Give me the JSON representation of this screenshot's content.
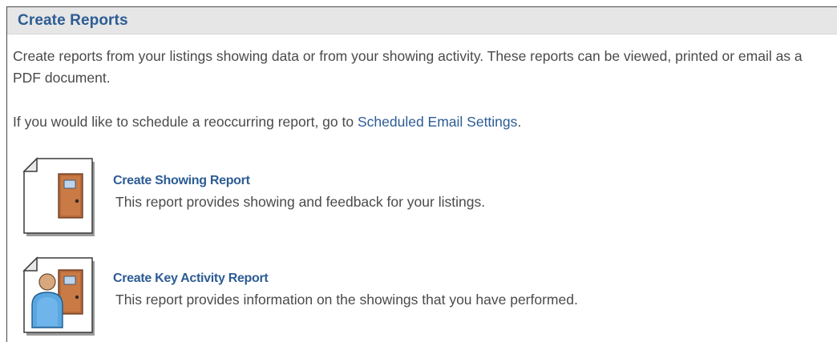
{
  "header": {
    "title": "Create Reports"
  },
  "intro": {
    "text": "Create reports from your listings showing data or from your showing activity. These reports can be viewed, printed or email as a PDF document."
  },
  "schedule": {
    "prefix": "If you would like to schedule a reoccurring report, go to ",
    "link_label": "Scheduled Email Settings",
    "suffix": "."
  },
  "reports": [
    {
      "title": "Create Showing Report",
      "description": "This report provides showing and feedback for your listings.",
      "icon": "door-document-icon"
    },
    {
      "title": "Create Key Activity Report",
      "description": "This report provides information on the showings that you have performed.",
      "icon": "person-door-document-icon"
    }
  ],
  "colors": {
    "link": "#2d5c94",
    "text": "#4a4a4a",
    "header_bg": "#e6e6e6"
  }
}
